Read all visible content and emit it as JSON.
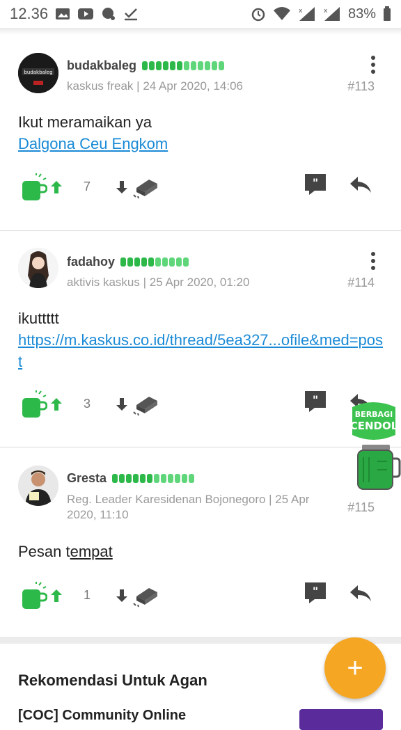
{
  "status_bar": {
    "time": "12.36",
    "battery": "83%"
  },
  "posts": [
    {
      "username": "budakbaleg",
      "rank": "kaskus freak",
      "date": "24 Apr 2020, 14:06",
      "number": "#113",
      "text": "Ikut meramaikan ya",
      "link": "Dalgona Ceu Engkom",
      "up_count": "7",
      "reputation_bars": 12
    },
    {
      "username": "fadahoy",
      "rank": "aktivis kaskus",
      "date": "25 Apr 2020, 01:20",
      "number": "#114",
      "text": "ikuttttt",
      "link": "https://m.kaskus.co.id/thread/5ea327...ofile&med=post",
      "up_count": "3",
      "reputation_bars": 10
    },
    {
      "username": "Gresta",
      "rank_line1": "Reg. Leader Karesidenan Bojonegoro | 25 Apr",
      "rank_line2": "2020, 11:10",
      "number": "#115",
      "text_plain": "Pesan t",
      "text_underlined": "empat",
      "up_count": "1",
      "reputation_bars": 12
    }
  ],
  "cendol_badge": {
    "line1": "BERBAGI",
    "line2": "CENDOL"
  },
  "recommendations": {
    "title": "Rekomendasi Untuk Agan",
    "first_item": "[COC] Community Online"
  },
  "fab": {
    "label": "+"
  },
  "colors": {
    "accent": "#f5a623",
    "link": "#1a8ad6",
    "green": "#2db84a"
  }
}
